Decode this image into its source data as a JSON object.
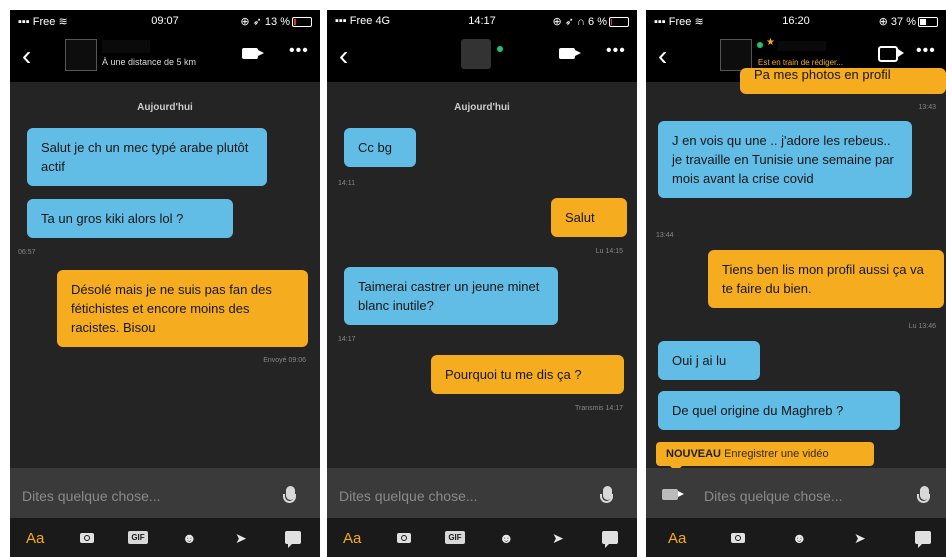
{
  "screens": [
    {
      "status": {
        "carrier": "Free",
        "time": "09:07",
        "battery": "13 %"
      },
      "header": {
        "distance": "À une distance de 5 km"
      },
      "day_label": "Aujourd'hui",
      "messages": [
        {
          "dir": "in",
          "text": "Salut je ch un mec typé arabe plutôt actif"
        },
        {
          "dir": "in",
          "text": "Ta un gros kiki alors lol ?",
          "time": "06:57"
        },
        {
          "dir": "out",
          "text": "Désolé mais je ne suis pas fan des fétichistes et encore moins des racistes. Bisou",
          "time": "Envoyé 09:06"
        }
      ],
      "composer": {
        "placeholder": "Dites quelque chose..."
      },
      "toolbar": {
        "text_tool": "Aa",
        "gif": "GIF"
      }
    },
    {
      "status": {
        "carrier": "Free 4G",
        "time": "14:17",
        "battery": "6 %"
      },
      "day_label": "Aujourd'hui",
      "messages": [
        {
          "dir": "in",
          "text": "Cc bg",
          "time": "14:11"
        },
        {
          "dir": "out",
          "text": "Salut",
          "time": "Lu 14:15"
        },
        {
          "dir": "in",
          "text": "Taimerai castrer un jeune minet blanc inutile?",
          "time": "14:17"
        },
        {
          "dir": "out",
          "text": "Pourquoi tu me dis ça ?",
          "time": "Transmis 14:17"
        }
      ],
      "composer": {
        "placeholder": "Dites quelque chose..."
      },
      "toolbar": {
        "text_tool": "Aa",
        "gif": "GIF"
      }
    },
    {
      "status": {
        "carrier": "Free",
        "time": "16:20",
        "battery": "37 %"
      },
      "header": {
        "typing": "Est en train de rédiger..."
      },
      "messages": [
        {
          "dir": "out",
          "text": "Pa mes photos en profil",
          "time": "13:43"
        },
        {
          "dir": "in",
          "text": "J en vois qu une .. j'adore les rebeus.. je travaille en Tunisie une semaine par mois avant la crise covid",
          "time": "13:44"
        },
        {
          "dir": "out",
          "text": "Tiens ben lis mon profil aussi ça va te faire du bien.",
          "time": "Lu 13:46"
        },
        {
          "dir": "in",
          "text": "Oui j ai lu"
        },
        {
          "dir": "in",
          "text": "De quel origine du Maghreb ?"
        }
      ],
      "banner": {
        "tag": "NOUVEAU",
        "text": "Enregistrer une vidéo"
      },
      "composer": {
        "placeholder": "Dites quelque chose..."
      },
      "toolbar": {
        "text_tool": "Aa"
      }
    }
  ]
}
